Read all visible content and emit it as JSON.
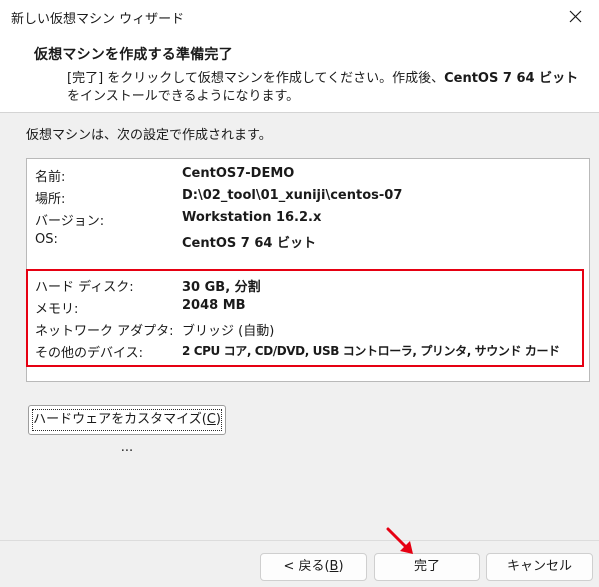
{
  "window": {
    "title": "新しい仮想マシン ウィザード",
    "close_icon": "close-icon"
  },
  "header": {
    "title": "仮想マシンを作成する準備完了",
    "desc_pre": "[完了] をクリックして仮想マシンを作成してください。作成後、",
    "desc_bold": "CentOS 7 64 ビット",
    "desc_post": " をインストールできるようになります。"
  },
  "intro_text": "仮想マシンは、次の設定で作成されます。",
  "settings": {
    "general": [
      {
        "label": "名前:",
        "value": "CentOS7-DEMO"
      },
      {
        "label": "場所:",
        "value": "D:\\02_tool\\01_xuniji\\centos-07"
      },
      {
        "label": "バージョン:",
        "value": "Workstation 16.2.x"
      },
      {
        "label": "OS:",
        "value": "CentOS 7 64 ビット"
      }
    ],
    "hardware": [
      {
        "label": "ハード ディスク:",
        "value": "30 GB, 分割"
      },
      {
        "label": "メモリ:",
        "value": "2048 MB"
      },
      {
        "label": "ネットワーク アダプタ:",
        "value": "ブリッジ (自動)"
      },
      {
        "label": "その他のデバイス:",
        "value": "2 CPU コア, CD/DVD, USB コントローラ, プリンタ, サウンド カード"
      }
    ],
    "highlight_color": "#e60012"
  },
  "buttons": {
    "customize_pre": "ハードウェアをカスタマイズ(",
    "customize_key": "C",
    "customize_post": ") ...",
    "back_pre": "< 戻る(",
    "back_key": "B",
    "back_post": ")",
    "finish": "完了",
    "cancel": "キャンセル"
  },
  "annotation": {
    "arrow_color": "#e60012",
    "arrow_icon": "red-arrow-icon"
  }
}
